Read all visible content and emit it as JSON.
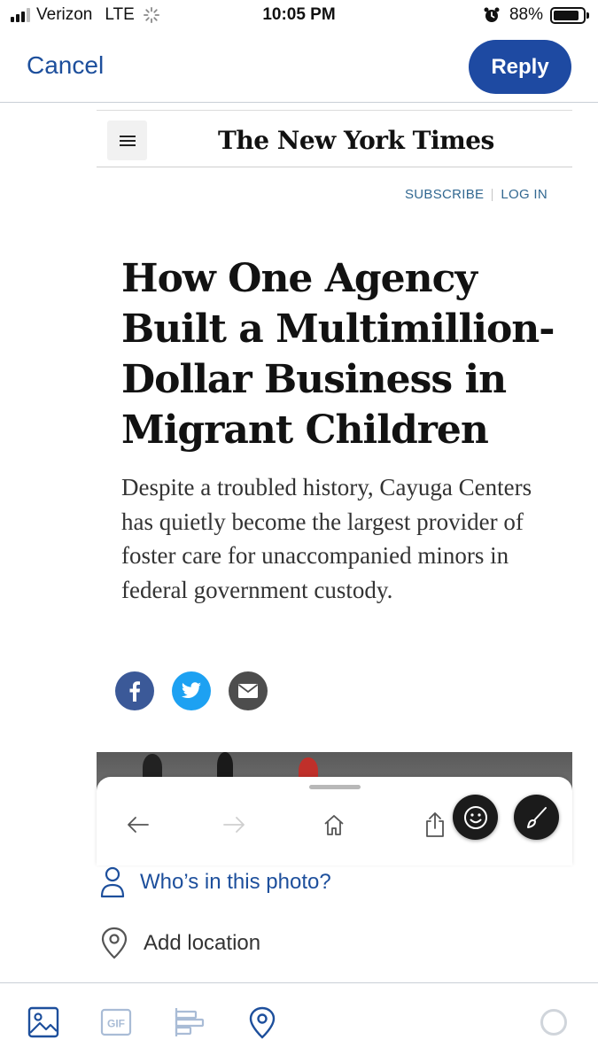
{
  "status_bar": {
    "carrier": "Verizon",
    "network": "LTE",
    "time": "10:05 PM",
    "battery_percent": "88%",
    "battery_level": 0.88,
    "signal_bars_filled": 3
  },
  "compose": {
    "cancel_label": "Cancel",
    "reply_label": "Reply",
    "accent_color": "#1e4aa2"
  },
  "article": {
    "masthead": "The New York Times",
    "subscribe_label": "SUBSCRIBE",
    "login_label": "LOG IN",
    "headline": "How One Agency Built a Multimillion-Dollar Business in Migrant Children",
    "summary": "Despite a troubled history, Cayuga Centers has quietly become the largest provider of foster care for unaccompanied minors in federal government custody.",
    "share_icons": [
      "facebook-icon",
      "twitter-icon",
      "email-icon"
    ]
  },
  "browser_toolbar": {
    "icons": [
      "back-arrow-icon",
      "forward-arrow-icon",
      "home-icon",
      "share-icon"
    ],
    "floating_buttons": [
      "emoji-icon",
      "paintbrush-icon"
    ]
  },
  "media_options": {
    "tag_people_label": "Who’s in this photo?",
    "add_location_label": "Add location"
  },
  "bottom_toolbar": {
    "icons": [
      "image-icon",
      "gif-icon",
      "poll-icon",
      "location-pin-icon",
      "character-count-ring"
    ],
    "gif_label": "GIF"
  }
}
